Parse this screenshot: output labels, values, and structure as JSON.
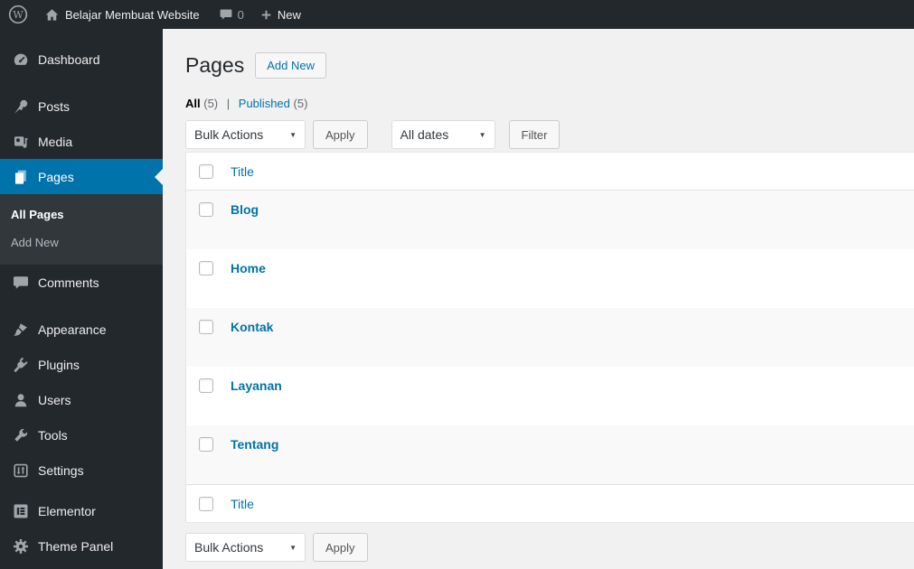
{
  "admin_bar": {
    "site_name": "Belajar Membuat Website",
    "comment_count": "0",
    "new_label": "New",
    "icons": [
      "wordpress-logo-icon",
      "home-icon",
      "comments-bubble-icon",
      "plus-icon"
    ]
  },
  "sidebar": {
    "items": [
      {
        "label": "Dashboard",
        "icon": "dashboard-icon"
      },
      {
        "label": "Posts",
        "icon": "pushpin-icon"
      },
      {
        "label": "Media",
        "icon": "media-icon"
      },
      {
        "label": "Pages",
        "icon": "pages-icon",
        "active": true
      },
      {
        "label": "Comments",
        "icon": "comment-icon"
      },
      {
        "label": "Appearance",
        "icon": "paintbrush-icon"
      },
      {
        "label": "Plugins",
        "icon": "plug-icon"
      },
      {
        "label": "Users",
        "icon": "user-icon"
      },
      {
        "label": "Tools",
        "icon": "wrench-icon"
      },
      {
        "label": "Settings",
        "icon": "sliders-icon"
      },
      {
        "label": "Elementor",
        "icon": "elementor-icon"
      },
      {
        "label": "Theme Panel",
        "icon": "gear-icon"
      }
    ],
    "submenu": {
      "items": [
        {
          "label": "All Pages",
          "current": true
        },
        {
          "label": "Add New"
        }
      ]
    }
  },
  "main": {
    "page_title": "Pages",
    "add_new_label": "Add New",
    "views": {
      "all_label": "All",
      "all_count": "(5)",
      "separator": "|",
      "published_label": "Published",
      "published_count": "(5)"
    },
    "toolbar": {
      "bulk_actions_label": "Bulk Actions",
      "apply_label": "Apply",
      "dates_label": "All dates",
      "filter_label": "Filter",
      "caret": "▼"
    },
    "table": {
      "column_title": "Title",
      "rows": [
        {
          "title": "Blog"
        },
        {
          "title": "Home"
        },
        {
          "title": "Kontak"
        },
        {
          "title": "Layanan"
        },
        {
          "title": "Tentang"
        }
      ]
    },
    "footer_toolbar": {
      "bulk_actions_label": "Bulk Actions",
      "apply_label": "Apply",
      "caret": "▼"
    }
  },
  "colors": {
    "accent_blue": "#0073aa",
    "admin_bar_bg": "#23282d",
    "submenu_bg": "#32373c",
    "content_bg": "#f1f1f1",
    "row_stripe": "#f9f9f9"
  }
}
